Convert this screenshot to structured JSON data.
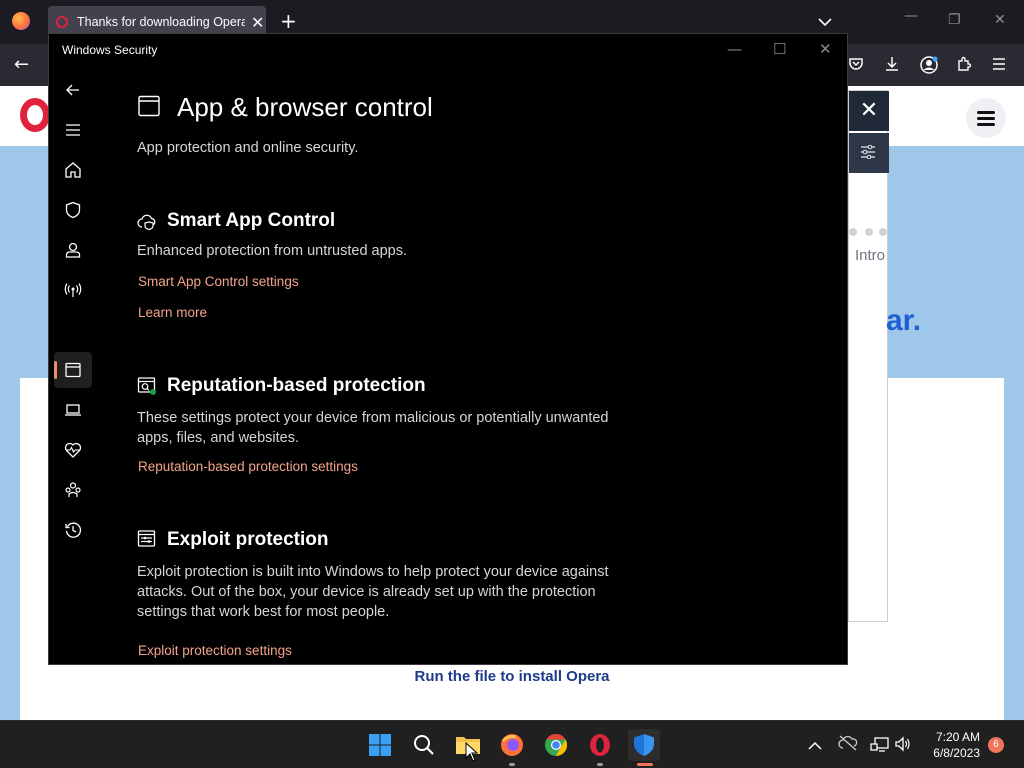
{
  "browser": {
    "tab_title": "Thanks for downloading Opera",
    "tab_close": "✕",
    "new_tab": "+",
    "back": "←"
  },
  "webpage": {
    "intro": "Intro",
    "big_fragment": "ar.",
    "run_text": "Run the file to install Opera",
    "panel_close": "✕"
  },
  "security_window": {
    "title": "Windows Security",
    "page_title": "App & browser control",
    "page_subtitle": "App protection and online security.",
    "sections": [
      {
        "icon": "cloud-shield-icon",
        "title": "Smart App Control",
        "description": "Enhanced protection from untrusted apps.",
        "links": [
          "Smart App Control settings",
          "Learn more"
        ]
      },
      {
        "icon": "reputation-icon",
        "title": "Reputation-based protection",
        "description": "These settings protect your device from malicious or potentially unwanted apps, files, and websites.",
        "links": [
          "Reputation-based protection settings"
        ]
      },
      {
        "icon": "exploit-icon",
        "title": "Exploit protection",
        "description": "Exploit protection is built into Windows to help protect your device against attacks.  Out of the box, your device is already set up with the protection settings that work best for most people.",
        "links": [
          "Exploit protection settings"
        ]
      }
    ],
    "nav_items": [
      "back-icon",
      "menu-icon",
      "home-icon",
      "shield-icon",
      "account-icon",
      "network-icon",
      "app-browser-icon",
      "device-icon",
      "health-icon",
      "family-icon",
      "history-icon",
      "settings-icon"
    ],
    "accent": "#f4a38b"
  },
  "taskbar": {
    "time": "7:20 AM",
    "date": "6/8/2023",
    "notification_count": "6"
  }
}
